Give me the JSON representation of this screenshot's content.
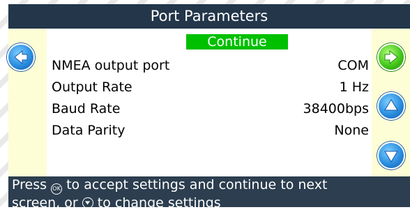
{
  "header": {
    "title": "Port Parameters"
  },
  "panel": {
    "continue_label": "Continue",
    "rows": [
      {
        "label": "NMEA output port",
        "value": "COM"
      },
      {
        "label": "Output Rate",
        "value": "1 Hz"
      },
      {
        "label": "Baud Rate",
        "value": "38400bps"
      },
      {
        "label": "Data Parity",
        "value": "None"
      }
    ]
  },
  "footer": {
    "line1_part1": "Press",
    "ok_glyph": "OK",
    "line1_part2": "to accept settings and continue to next",
    "line2_part1": "screen, or",
    "line2_part2": "to change settings"
  },
  "icons": {
    "left": "left-arrow-icon",
    "next": "right-arrow-icon",
    "up": "up-arrow-icon",
    "down": "down-arrow-icon",
    "ok": "ok-key-icon",
    "down_key": "down-key-icon"
  },
  "colors": {
    "title_bar": "#23364a",
    "screen_bg": "#fdfdd6",
    "continue_bg": "#00c000",
    "nav_blue": "#2a8ee0",
    "nav_green": "#44c81a",
    "footer_bar": "#2c3e4f"
  }
}
